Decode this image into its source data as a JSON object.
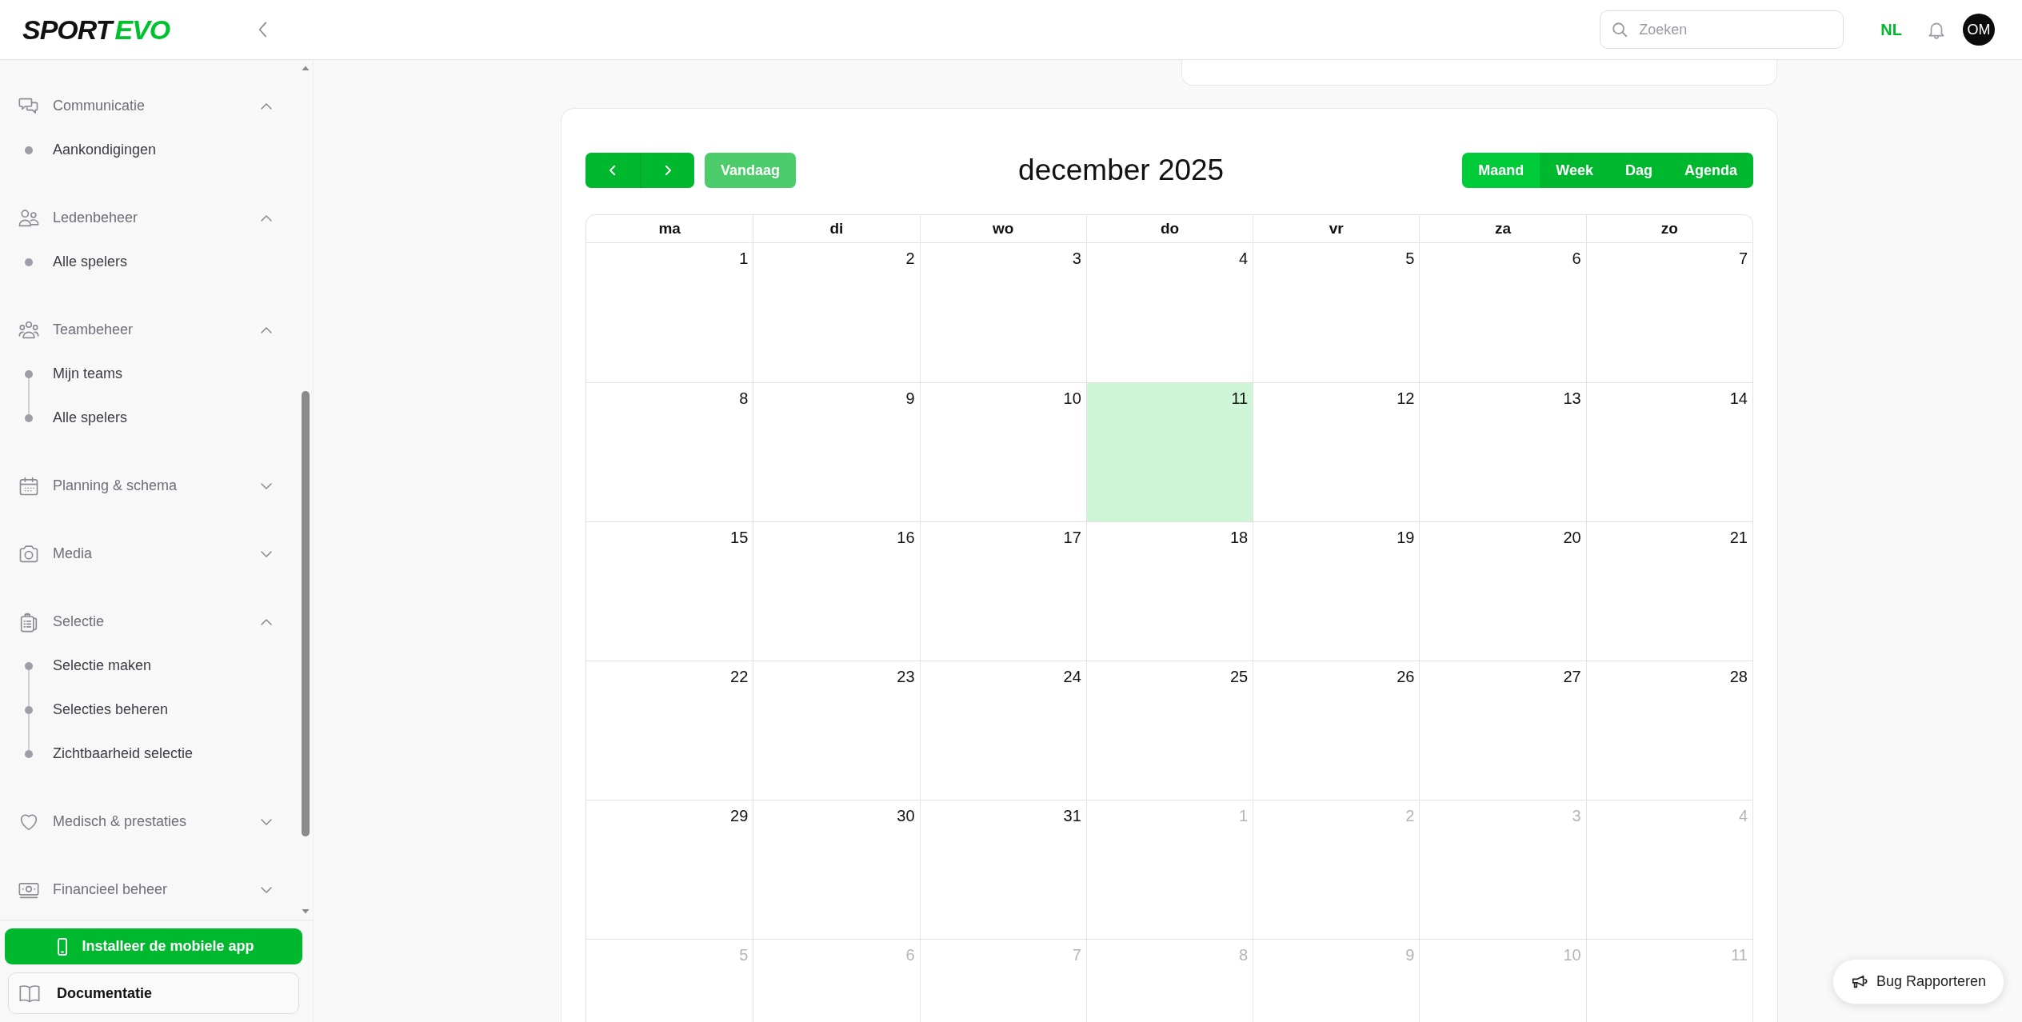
{
  "header": {
    "logo": {
      "dark_part": "SPORT",
      "green_part": "EVO"
    },
    "search": {
      "placeholder": "Zoeken"
    },
    "language": "NL",
    "avatar": "OM"
  },
  "sidebar": {
    "sections": [
      {
        "label": "Communicatie",
        "expanded": true,
        "children": [
          {
            "label": "Aankondigingen"
          }
        ]
      },
      {
        "label": "Ledenbeheer",
        "expanded": true,
        "children": [
          {
            "label": "Alle spelers"
          }
        ]
      },
      {
        "label": "Teambeheer",
        "expanded": true,
        "children": [
          {
            "label": "Mijn teams"
          },
          {
            "label": "Alle spelers"
          }
        ]
      },
      {
        "label": "Planning & schema",
        "expanded": false
      },
      {
        "label": "Media",
        "expanded": false
      },
      {
        "label": "Selectie",
        "expanded": true,
        "children": [
          {
            "label": "Selectie maken"
          },
          {
            "label": "Selecties beheren"
          },
          {
            "label": "Zichtbaarheid selectie"
          }
        ]
      },
      {
        "label": "Medisch & prestaties",
        "expanded": false
      },
      {
        "label": "Financieel beheer",
        "expanded": false
      }
    ],
    "install_button": "Installeer de mobiele app",
    "documentation": "Documentatie"
  },
  "calendar": {
    "today_button": "Vandaag",
    "title": "december 2025",
    "views": [
      {
        "label": "Maand",
        "selected": true
      },
      {
        "label": "Week",
        "selected": false
      },
      {
        "label": "Dag",
        "selected": false
      },
      {
        "label": "Agenda",
        "selected": false
      }
    ],
    "weekdays": [
      "ma",
      "di",
      "wo",
      "do",
      "vr",
      "za",
      "zo"
    ],
    "weeks": [
      [
        {
          "day": "1",
          "other_month": false,
          "today": false
        },
        {
          "day": "2",
          "other_month": false,
          "today": false
        },
        {
          "day": "3",
          "other_month": false,
          "today": false
        },
        {
          "day": "4",
          "other_month": false,
          "today": false
        },
        {
          "day": "5",
          "other_month": false,
          "today": false
        },
        {
          "day": "6",
          "other_month": false,
          "today": false
        },
        {
          "day": "7",
          "other_month": false,
          "today": false
        }
      ],
      [
        {
          "day": "8",
          "other_month": false,
          "today": false
        },
        {
          "day": "9",
          "other_month": false,
          "today": false
        },
        {
          "day": "10",
          "other_month": false,
          "today": false
        },
        {
          "day": "11",
          "other_month": false,
          "today": true
        },
        {
          "day": "12",
          "other_month": false,
          "today": false
        },
        {
          "day": "13",
          "other_month": false,
          "today": false
        },
        {
          "day": "14",
          "other_month": false,
          "today": false
        }
      ],
      [
        {
          "day": "15",
          "other_month": false,
          "today": false
        },
        {
          "day": "16",
          "other_month": false,
          "today": false
        },
        {
          "day": "17",
          "other_month": false,
          "today": false
        },
        {
          "day": "18",
          "other_month": false,
          "today": false
        },
        {
          "day": "19",
          "other_month": false,
          "today": false
        },
        {
          "day": "20",
          "other_month": false,
          "today": false
        },
        {
          "day": "21",
          "other_month": false,
          "today": false
        }
      ],
      [
        {
          "day": "22",
          "other_month": false,
          "today": false
        },
        {
          "day": "23",
          "other_month": false,
          "today": false
        },
        {
          "day": "24",
          "other_month": false,
          "today": false
        },
        {
          "day": "25",
          "other_month": false,
          "today": false
        },
        {
          "day": "26",
          "other_month": false,
          "today": false
        },
        {
          "day": "27",
          "other_month": false,
          "today": false
        },
        {
          "day": "28",
          "other_month": false,
          "today": false
        }
      ],
      [
        {
          "day": "29",
          "other_month": false,
          "today": false
        },
        {
          "day": "30",
          "other_month": false,
          "today": false
        },
        {
          "day": "31",
          "other_month": false,
          "today": false
        },
        {
          "day": "1",
          "other_month": true,
          "today": false
        },
        {
          "day": "2",
          "other_month": true,
          "today": false
        },
        {
          "day": "3",
          "other_month": true,
          "today": false
        },
        {
          "day": "4",
          "other_month": true,
          "today": false
        }
      ],
      [
        {
          "day": "5",
          "other_month": true,
          "today": false
        },
        {
          "day": "6",
          "other_month": true,
          "today": false
        },
        {
          "day": "7",
          "other_month": true,
          "today": false
        },
        {
          "day": "8",
          "other_month": true,
          "today": false
        },
        {
          "day": "9",
          "other_month": true,
          "today": false
        },
        {
          "day": "10",
          "other_month": true,
          "today": false
        },
        {
          "day": "11",
          "other_month": true,
          "today": false
        }
      ]
    ]
  },
  "bug_button": "Bug Rapporteren"
}
